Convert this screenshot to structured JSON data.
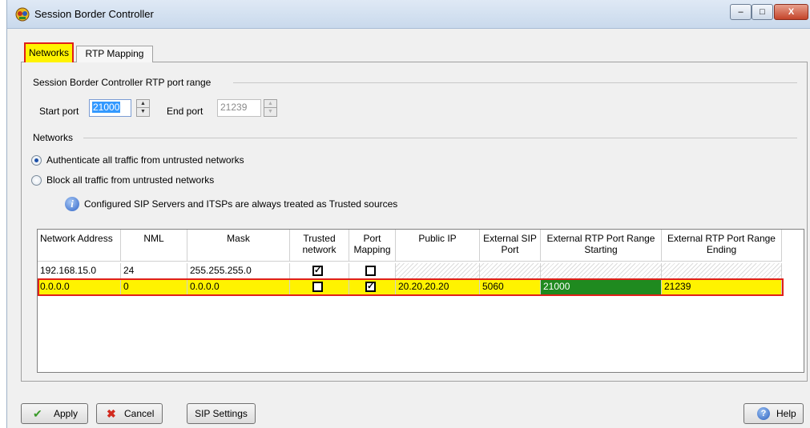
{
  "window": {
    "title": "Session Border Controller",
    "minimize": "–",
    "maximize": "□",
    "close": "X"
  },
  "tabs": {
    "networks": "Networks",
    "rtp_mapping": "RTP Mapping"
  },
  "rtp_range": {
    "section_label": "Session Border Controller RTP port range",
    "start_label": "Start port",
    "start_value": "21000",
    "end_label": "End port",
    "end_value": "21239"
  },
  "networks": {
    "section_label": "Networks",
    "option_authenticate": "Authenticate all traffic from untrusted networks",
    "option_block": "Block all traffic from untrusted networks",
    "selected_option": "authenticate",
    "info_text": "Configured SIP Servers and ITSPs are always treated as Trusted sources"
  },
  "grid": {
    "headers": {
      "network_address": "Network Address",
      "nml": "NML",
      "mask": "Mask",
      "trusted_1": "Trusted",
      "trusted_2": "network",
      "port_mapping_1": "Port",
      "port_mapping_2": "Mapping",
      "public_ip": "Public IP",
      "ext_sip_1": "External SIP",
      "ext_sip_2": "Port",
      "rtp_start_1": "External RTP Port Range",
      "rtp_start_2": "Starting",
      "rtp_end_1": "External RTP Port Range",
      "rtp_end_2": "Ending"
    },
    "rows": [
      {
        "network_address": "192.168.15.0",
        "nml": "24",
        "mask": "255.255.255.0",
        "trusted": "✓",
        "port_mapping": "",
        "public_ip": "",
        "ext_sip_port": "",
        "rtp_start": "",
        "rtp_end": ""
      },
      {
        "network_address": "0.0.0.0",
        "nml": "0",
        "mask": "0.0.0.0",
        "trusted": "",
        "port_mapping": "✓",
        "public_ip": "20.20.20.20",
        "ext_sip_port": "5060",
        "rtp_start": "21000",
        "rtp_end": "21239"
      }
    ]
  },
  "buttons": {
    "apply": "Apply",
    "cancel": "Cancel",
    "sip_settings": "SIP Settings",
    "help": "Help"
  },
  "colors": {
    "highlight_yellow": "#fff300",
    "highlight_red": "#e0201a",
    "cell_green": "#1f8a1f"
  }
}
